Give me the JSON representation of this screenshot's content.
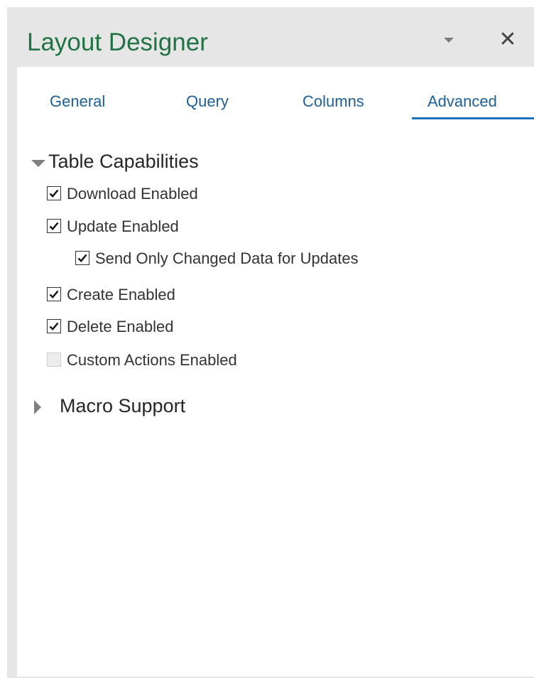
{
  "panel": {
    "title": "Layout Designer",
    "dropdown_icon": "chevron-down-icon",
    "close_glyph": "✕"
  },
  "tabs": [
    {
      "label": "General",
      "selected": false
    },
    {
      "label": "Query",
      "selected": false
    },
    {
      "label": "Columns",
      "selected": false
    },
    {
      "label": "Advanced",
      "selected": true
    }
  ],
  "sections": {
    "table_capabilities": {
      "label": "Table Capabilities",
      "expanded": true,
      "options": [
        {
          "label": "Download Enabled",
          "checked": true,
          "enabled": true
        },
        {
          "label": "Update Enabled",
          "checked": true,
          "enabled": true
        },
        {
          "label": "Send Only Changed Data for Updates",
          "checked": true,
          "enabled": true,
          "indent": 1
        },
        {
          "label": "Create Enabled",
          "checked": true,
          "enabled": true
        },
        {
          "label": "Delete Enabled",
          "checked": true,
          "enabled": true
        },
        {
          "label": "Custom Actions Enabled",
          "checked": false,
          "enabled": false
        }
      ]
    },
    "macro_support": {
      "label": "Macro Support",
      "expanded": false
    }
  },
  "colors": {
    "title": "#217346",
    "tab_text": "#1e5f99",
    "tab_underline": "#1e73be",
    "header_bg": "#e6e6e6"
  }
}
